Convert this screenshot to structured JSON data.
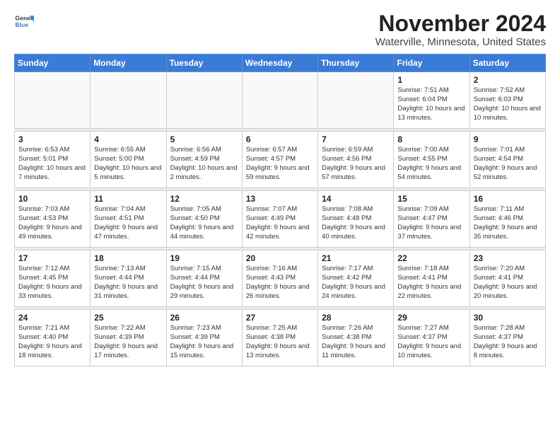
{
  "logo": {
    "line1": "General",
    "line2": "Blue"
  },
  "header": {
    "month": "November 2024",
    "location": "Waterville, Minnesota, United States"
  },
  "weekdays": [
    "Sunday",
    "Monday",
    "Tuesday",
    "Wednesday",
    "Thursday",
    "Friday",
    "Saturday"
  ],
  "weeks": [
    [
      {
        "day": "",
        "info": ""
      },
      {
        "day": "",
        "info": ""
      },
      {
        "day": "",
        "info": ""
      },
      {
        "day": "",
        "info": ""
      },
      {
        "day": "",
        "info": ""
      },
      {
        "day": "1",
        "info": "Sunrise: 7:51 AM\nSunset: 6:04 PM\nDaylight: 10 hours\nand 13 minutes."
      },
      {
        "day": "2",
        "info": "Sunrise: 7:52 AM\nSunset: 6:03 PM\nDaylight: 10 hours\nand 10 minutes."
      }
    ],
    [
      {
        "day": "3",
        "info": "Sunrise: 6:53 AM\nSunset: 5:01 PM\nDaylight: 10 hours\nand 7 minutes."
      },
      {
        "day": "4",
        "info": "Sunrise: 6:55 AM\nSunset: 5:00 PM\nDaylight: 10 hours\nand 5 minutes."
      },
      {
        "day": "5",
        "info": "Sunrise: 6:56 AM\nSunset: 4:59 PM\nDaylight: 10 hours\nand 2 minutes."
      },
      {
        "day": "6",
        "info": "Sunrise: 6:57 AM\nSunset: 4:57 PM\nDaylight: 9 hours\nand 59 minutes."
      },
      {
        "day": "7",
        "info": "Sunrise: 6:59 AM\nSunset: 4:56 PM\nDaylight: 9 hours\nand 57 minutes."
      },
      {
        "day": "8",
        "info": "Sunrise: 7:00 AM\nSunset: 4:55 PM\nDaylight: 9 hours\nand 54 minutes."
      },
      {
        "day": "9",
        "info": "Sunrise: 7:01 AM\nSunset: 4:54 PM\nDaylight: 9 hours\nand 52 minutes."
      }
    ],
    [
      {
        "day": "10",
        "info": "Sunrise: 7:03 AM\nSunset: 4:53 PM\nDaylight: 9 hours\nand 49 minutes."
      },
      {
        "day": "11",
        "info": "Sunrise: 7:04 AM\nSunset: 4:51 PM\nDaylight: 9 hours\nand 47 minutes."
      },
      {
        "day": "12",
        "info": "Sunrise: 7:05 AM\nSunset: 4:50 PM\nDaylight: 9 hours\nand 44 minutes."
      },
      {
        "day": "13",
        "info": "Sunrise: 7:07 AM\nSunset: 4:49 PM\nDaylight: 9 hours\nand 42 minutes."
      },
      {
        "day": "14",
        "info": "Sunrise: 7:08 AM\nSunset: 4:48 PM\nDaylight: 9 hours\nand 40 minutes."
      },
      {
        "day": "15",
        "info": "Sunrise: 7:09 AM\nSunset: 4:47 PM\nDaylight: 9 hours\nand 37 minutes."
      },
      {
        "day": "16",
        "info": "Sunrise: 7:11 AM\nSunset: 4:46 PM\nDaylight: 9 hours\nand 35 minutes."
      }
    ],
    [
      {
        "day": "17",
        "info": "Sunrise: 7:12 AM\nSunset: 4:45 PM\nDaylight: 9 hours\nand 33 minutes."
      },
      {
        "day": "18",
        "info": "Sunrise: 7:13 AM\nSunset: 4:44 PM\nDaylight: 9 hours\nand 31 minutes."
      },
      {
        "day": "19",
        "info": "Sunrise: 7:15 AM\nSunset: 4:44 PM\nDaylight: 9 hours\nand 29 minutes."
      },
      {
        "day": "20",
        "info": "Sunrise: 7:16 AM\nSunset: 4:43 PM\nDaylight: 9 hours\nand 26 minutes."
      },
      {
        "day": "21",
        "info": "Sunrise: 7:17 AM\nSunset: 4:42 PM\nDaylight: 9 hours\nand 24 minutes."
      },
      {
        "day": "22",
        "info": "Sunrise: 7:18 AM\nSunset: 4:41 PM\nDaylight: 9 hours\nand 22 minutes."
      },
      {
        "day": "23",
        "info": "Sunrise: 7:20 AM\nSunset: 4:41 PM\nDaylight: 9 hours\nand 20 minutes."
      }
    ],
    [
      {
        "day": "24",
        "info": "Sunrise: 7:21 AM\nSunset: 4:40 PM\nDaylight: 9 hours\nand 18 minutes."
      },
      {
        "day": "25",
        "info": "Sunrise: 7:22 AM\nSunset: 4:39 PM\nDaylight: 9 hours\nand 17 minutes."
      },
      {
        "day": "26",
        "info": "Sunrise: 7:23 AM\nSunset: 4:39 PM\nDaylight: 9 hours\nand 15 minutes."
      },
      {
        "day": "27",
        "info": "Sunrise: 7:25 AM\nSunset: 4:38 PM\nDaylight: 9 hours\nand 13 minutes."
      },
      {
        "day": "28",
        "info": "Sunrise: 7:26 AM\nSunset: 4:38 PM\nDaylight: 9 hours\nand 11 minutes."
      },
      {
        "day": "29",
        "info": "Sunrise: 7:27 AM\nSunset: 4:37 PM\nDaylight: 9 hours\nand 10 minutes."
      },
      {
        "day": "30",
        "info": "Sunrise: 7:28 AM\nSunset: 4:37 PM\nDaylight: 9 hours\nand 8 minutes."
      }
    ]
  ]
}
